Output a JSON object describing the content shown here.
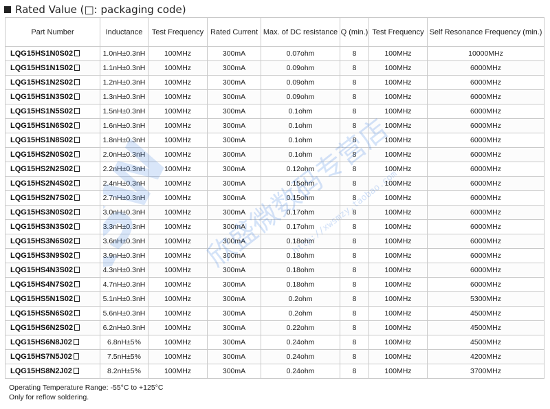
{
  "title": "Rated Value (□: packaging code)",
  "table": {
    "headers": [
      "Part Number",
      "Inductance",
      "Test Frequency",
      "Rated Current",
      "Max. of DC resistance",
      "Q (min.)",
      "Test Frequency",
      "Self Resonance Frequency (min.)"
    ],
    "rows": [
      {
        "part": "LQG15HS1N0S02",
        "inductance": "1.0nH±0.3nH",
        "test_freq": "100MHz",
        "current": "300mA",
        "dcr": "0.07ohm",
        "q": "8",
        "q_freq": "100MHz",
        "srf": "10000MHz"
      },
      {
        "part": "LQG15HS1N1S02",
        "inductance": "1.1nH±0.3nH",
        "test_freq": "100MHz",
        "current": "300mA",
        "dcr": "0.09ohm",
        "q": "8",
        "q_freq": "100MHz",
        "srf": "6000MHz"
      },
      {
        "part": "LQG15HS1N2S02",
        "inductance": "1.2nH±0.3nH",
        "test_freq": "100MHz",
        "current": "300mA",
        "dcr": "0.09ohm",
        "q": "8",
        "q_freq": "100MHz",
        "srf": "6000MHz"
      },
      {
        "part": "LQG15HS1N3S02",
        "inductance": "1.3nH±0.3nH",
        "test_freq": "100MHz",
        "current": "300mA",
        "dcr": "0.09ohm",
        "q": "8",
        "q_freq": "100MHz",
        "srf": "6000MHz"
      },
      {
        "part": "LQG15HS1N5S02",
        "inductance": "1.5nH±0.3nH",
        "test_freq": "100MHz",
        "current": "300mA",
        "dcr": "0.1ohm",
        "q": "8",
        "q_freq": "100MHz",
        "srf": "6000MHz"
      },
      {
        "part": "LQG15HS1N6S02",
        "inductance": "1.6nH±0.3nH",
        "test_freq": "100MHz",
        "current": "300mA",
        "dcr": "0.1ohm",
        "q": "8",
        "q_freq": "100MHz",
        "srf": "6000MHz"
      },
      {
        "part": "LQG15HS1N8S02",
        "inductance": "1.8nH±0.3nH",
        "test_freq": "100MHz",
        "current": "300mA",
        "dcr": "0.1ohm",
        "q": "8",
        "q_freq": "100MHz",
        "srf": "6000MHz"
      },
      {
        "part": "LQG15HS2N0S02",
        "inductance": "2.0nH±0.3nH",
        "test_freq": "100MHz",
        "current": "300mA",
        "dcr": "0.1ohm",
        "q": "8",
        "q_freq": "100MHz",
        "srf": "6000MHz"
      },
      {
        "part": "LQG15HS2N2S02",
        "inductance": "2.2nH±0.3nH",
        "test_freq": "100MHz",
        "current": "300mA",
        "dcr": "0.12ohm",
        "q": "8",
        "q_freq": "100MHz",
        "srf": "6000MHz"
      },
      {
        "part": "LQG15HS2N4S02",
        "inductance": "2.4nH±0.3nH",
        "test_freq": "100MHz",
        "current": "300mA",
        "dcr": "0.15ohm",
        "q": "8",
        "q_freq": "100MHz",
        "srf": "6000MHz"
      },
      {
        "part": "LQG15HS2N7S02",
        "inductance": "2.7nH±0.3nH",
        "test_freq": "100MHz",
        "current": "300mA",
        "dcr": "0.15ohm",
        "q": "8",
        "q_freq": "100MHz",
        "srf": "6000MHz"
      },
      {
        "part": "LQG15HS3N0S02",
        "inductance": "3.0nH±0.3nH",
        "test_freq": "100MHz",
        "current": "300mA",
        "dcr": "0.17ohm",
        "q": "8",
        "q_freq": "100MHz",
        "srf": "6000MHz"
      },
      {
        "part": "LQG15HS3N3S02",
        "inductance": "3.3nH±0.3nH",
        "test_freq": "100MHz",
        "current": "300mA",
        "dcr": "0.17ohm",
        "q": "8",
        "q_freq": "100MHz",
        "srf": "6000MHz"
      },
      {
        "part": "LQG15HS3N6S02",
        "inductance": "3.6nH±0.3nH",
        "test_freq": "100MHz",
        "current": "300mA",
        "dcr": "0.18ohm",
        "q": "8",
        "q_freq": "100MHz",
        "srf": "6000MHz"
      },
      {
        "part": "LQG15HS3N9S02",
        "inductance": "3.9nH±0.3nH",
        "test_freq": "100MHz",
        "current": "300mA",
        "dcr": "0.18ohm",
        "q": "8",
        "q_freq": "100MHz",
        "srf": "6000MHz"
      },
      {
        "part": "LQG15HS4N3S02",
        "inductance": "4.3nH±0.3nH",
        "test_freq": "100MHz",
        "current": "300mA",
        "dcr": "0.18ohm",
        "q": "8",
        "q_freq": "100MHz",
        "srf": "6000MHz"
      },
      {
        "part": "LQG15HS4N7S02",
        "inductance": "4.7nH±0.3nH",
        "test_freq": "100MHz",
        "current": "300mA",
        "dcr": "0.18ohm",
        "q": "8",
        "q_freq": "100MHz",
        "srf": "6000MHz"
      },
      {
        "part": "LQG15HS5N1S02",
        "inductance": "5.1nH±0.3nH",
        "test_freq": "100MHz",
        "current": "300mA",
        "dcr": "0.2ohm",
        "q": "8",
        "q_freq": "100MHz",
        "srf": "5300MHz"
      },
      {
        "part": "LQG15HS5N6S02",
        "inductance": "5.6nH±0.3nH",
        "test_freq": "100MHz",
        "current": "300mA",
        "dcr": "0.2ohm",
        "q": "8",
        "q_freq": "100MHz",
        "srf": "4500MHz"
      },
      {
        "part": "LQG15HS6N2S02",
        "inductance": "6.2nH±0.3nH",
        "test_freq": "100MHz",
        "current": "300mA",
        "dcr": "0.22ohm",
        "q": "8",
        "q_freq": "100MHz",
        "srf": "4500MHz"
      },
      {
        "part": "LQG15HS6N8J02",
        "inductance": "6.8nH±5%",
        "test_freq": "100MHz",
        "current": "300mA",
        "dcr": "0.24ohm",
        "q": "8",
        "q_freq": "100MHz",
        "srf": "4500MHz"
      },
      {
        "part": "LQG15HS7N5J02",
        "inductance": "7.5nH±5%",
        "test_freq": "100MHz",
        "current": "300mA",
        "dcr": "0.24ohm",
        "q": "8",
        "q_freq": "100MHz",
        "srf": "4200MHz"
      },
      {
        "part": "LQG15HS8N2J02",
        "inductance": "8.2nH±5%",
        "test_freq": "100MHz",
        "current": "300mA",
        "dcr": "0.24ohm",
        "q": "8",
        "q_freq": "100MHz",
        "srf": "3700MHz"
      }
    ]
  },
  "notes": [
    "Operating Temperature Range: -55°C to +125°C",
    "Only for reflow soldering."
  ],
  "watermark": {
    "logo": "XSW",
    "chinese": "欣盛微数码专营店",
    "url": "http://xwsmzy.taobao.com",
    "color_blue": "#3d7fe0",
    "color_green": "#4caf50"
  }
}
